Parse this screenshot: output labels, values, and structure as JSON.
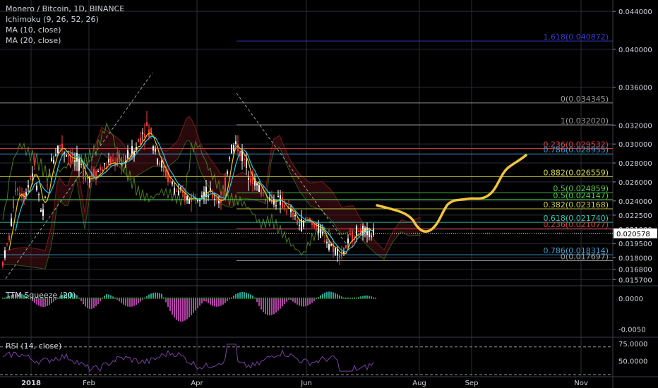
{
  "header": {
    "symbol_line": "Monero / Bitcoin, 1D, BINANCE",
    "indicators": [
      "Ichimoku (9, 26, 52, 26)",
      "MA (10, close)",
      "MA (20, close)"
    ]
  },
  "colors": {
    "background": "#000000",
    "grid": "#2a2e39",
    "bull_candle": "#ffffff",
    "bear_candle": "#ff3b3b",
    "ma10": "#f0c419",
    "ma20": "#2ec7e6",
    "ichimoku_lagging": "#4b7a20",
    "ichimoku_base": "#8b1515",
    "cloud": "#3a0d10",
    "projection": "#f2c53d",
    "rsi": "#7b3fa6",
    "ttm_pos": "#26a69a",
    "ttm_neg": "#b342a8"
  },
  "chart_data": [
    {
      "type": "candlestick",
      "title": "Monero / Bitcoin, 1D, BINANCE",
      "ylim": [
        0.0152,
        0.0452
      ],
      "yticks": [
        "0.044000",
        "0.040000",
        "0.036000",
        "0.032000",
        "0.030000",
        "0.028000",
        "0.026000",
        "0.024000",
        "0.022500",
        "0.021000",
        "0.019500",
        "0.018000",
        "0.016800",
        "0.015700"
      ],
      "last_price_label": "0.020578",
      "last_price": 0.020578,
      "xlabels": [
        "2018",
        "Feb",
        "Apr",
        "Jun",
        "Aug",
        "Sep",
        "Nov"
      ],
      "fib_levels": [
        {
          "label": "1.618(0.040872)",
          "value": 0.040872,
          "color": "#3a3ad0"
        },
        {
          "label": "0(0.034345)",
          "value": 0.034345,
          "color": "#9a9a9a"
        },
        {
          "label": "1(0.032020)",
          "value": 0.03202,
          "color": "#9a9a9a"
        },
        {
          "label": "0.236(0.029532)",
          "value": 0.029532,
          "color": "#d94040"
        },
        {
          "label": "0.786(0.028955)",
          "value": 0.028955,
          "color": "#3fa0d8"
        },
        {
          "label": "0.882(0.026559)",
          "value": 0.026559,
          "color": "#d8d84a"
        },
        {
          "label": "0.5(0.024859)",
          "value": 0.024859,
          "color": "#4fcf4f"
        },
        {
          "label": "0.5(0.024147)",
          "value": 0.024147,
          "color": "#4fcf4f"
        },
        {
          "label": "0.382(0.023168)",
          "value": 0.023168,
          "color": "#cfcf4a"
        },
        {
          "label": "0.618(0.021740)",
          "value": 0.02174,
          "color": "#2ec7b0"
        },
        {
          "label": "0.236(0.021077)",
          "value": 0.021077,
          "color": "#d94040"
        },
        {
          "label": "0.786(0.018314)",
          "value": 0.018314,
          "color": "#3fa0d8"
        },
        {
          "label": "0(0.017697)",
          "value": 0.017697,
          "color": "#9a9a9a"
        }
      ]
    },
    {
      "type": "histogram",
      "title": "TTM Squeeze (20)",
      "ylim": [
        -0.0062,
        0.0018
      ],
      "yticks": [
        "0.0000",
        "-0.0050"
      ]
    },
    {
      "type": "line",
      "title": "RSI (14, close)",
      "ylim": [
        28,
        82
      ],
      "yticks": [
        "75.0000",
        "50.0000"
      ],
      "bands": [
        70,
        30
      ]
    }
  ]
}
